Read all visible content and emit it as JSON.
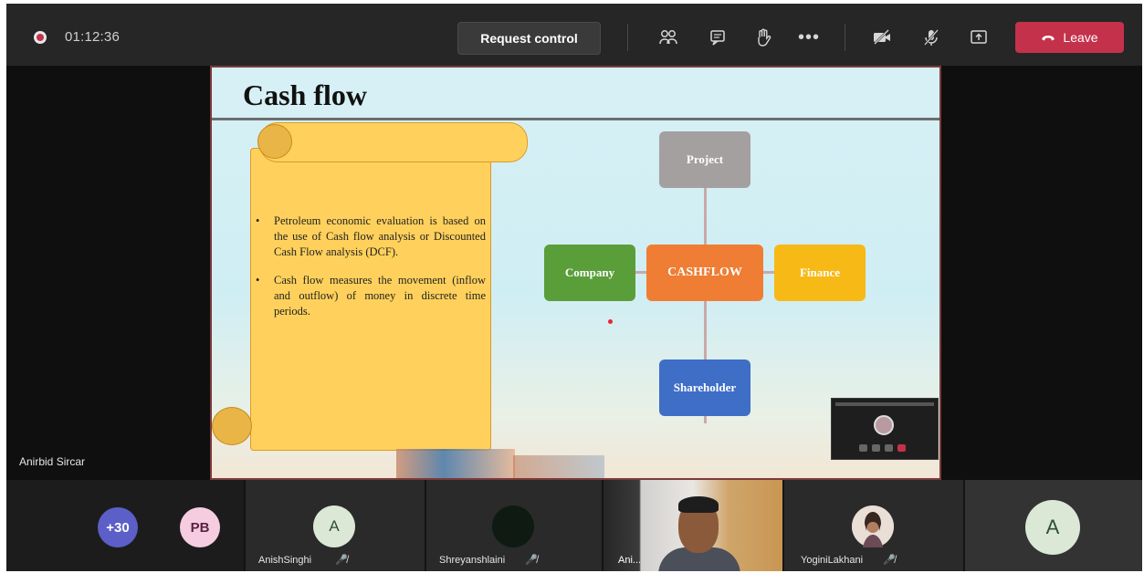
{
  "meeting": {
    "timer": "01:12:36",
    "request_control_label": "Request control",
    "leave_label": "Leave",
    "accent": "#c4314b"
  },
  "toolbar_icons": [
    "participants-icon",
    "chat-icon",
    "raise-hand-icon",
    "more-options-icon",
    "camera-off-icon",
    "mic-off-icon",
    "share-tray-icon"
  ],
  "presenter": {
    "name": "Anirbid Sircar"
  },
  "slide": {
    "title": "Cash flow",
    "bullets": [
      "Petroleum economic evaluation is based on the use of Cash flow analysis or Discounted Cash Flow analysis (DCF).",
      "Cash flow measures the movement (inflow and outflow) of money in discrete time periods."
    ],
    "diagram": {
      "center": "CASHFLOW",
      "top": "Project",
      "left": "Company",
      "right": "Finance",
      "bottom": "Shareholder"
    }
  },
  "participants": {
    "overflow_count": "+30",
    "tiles": [
      {
        "initials": "PB",
        "name": ""
      },
      {
        "initials": "A",
        "name": "AnishSinghi"
      },
      {
        "initials": "",
        "name": "Shreyanshlaini"
      },
      {
        "initials": "",
        "name": "Ani..."
      },
      {
        "initials": "",
        "name": "YoginiLakhani"
      },
      {
        "initials": "A",
        "name": ""
      }
    ]
  }
}
